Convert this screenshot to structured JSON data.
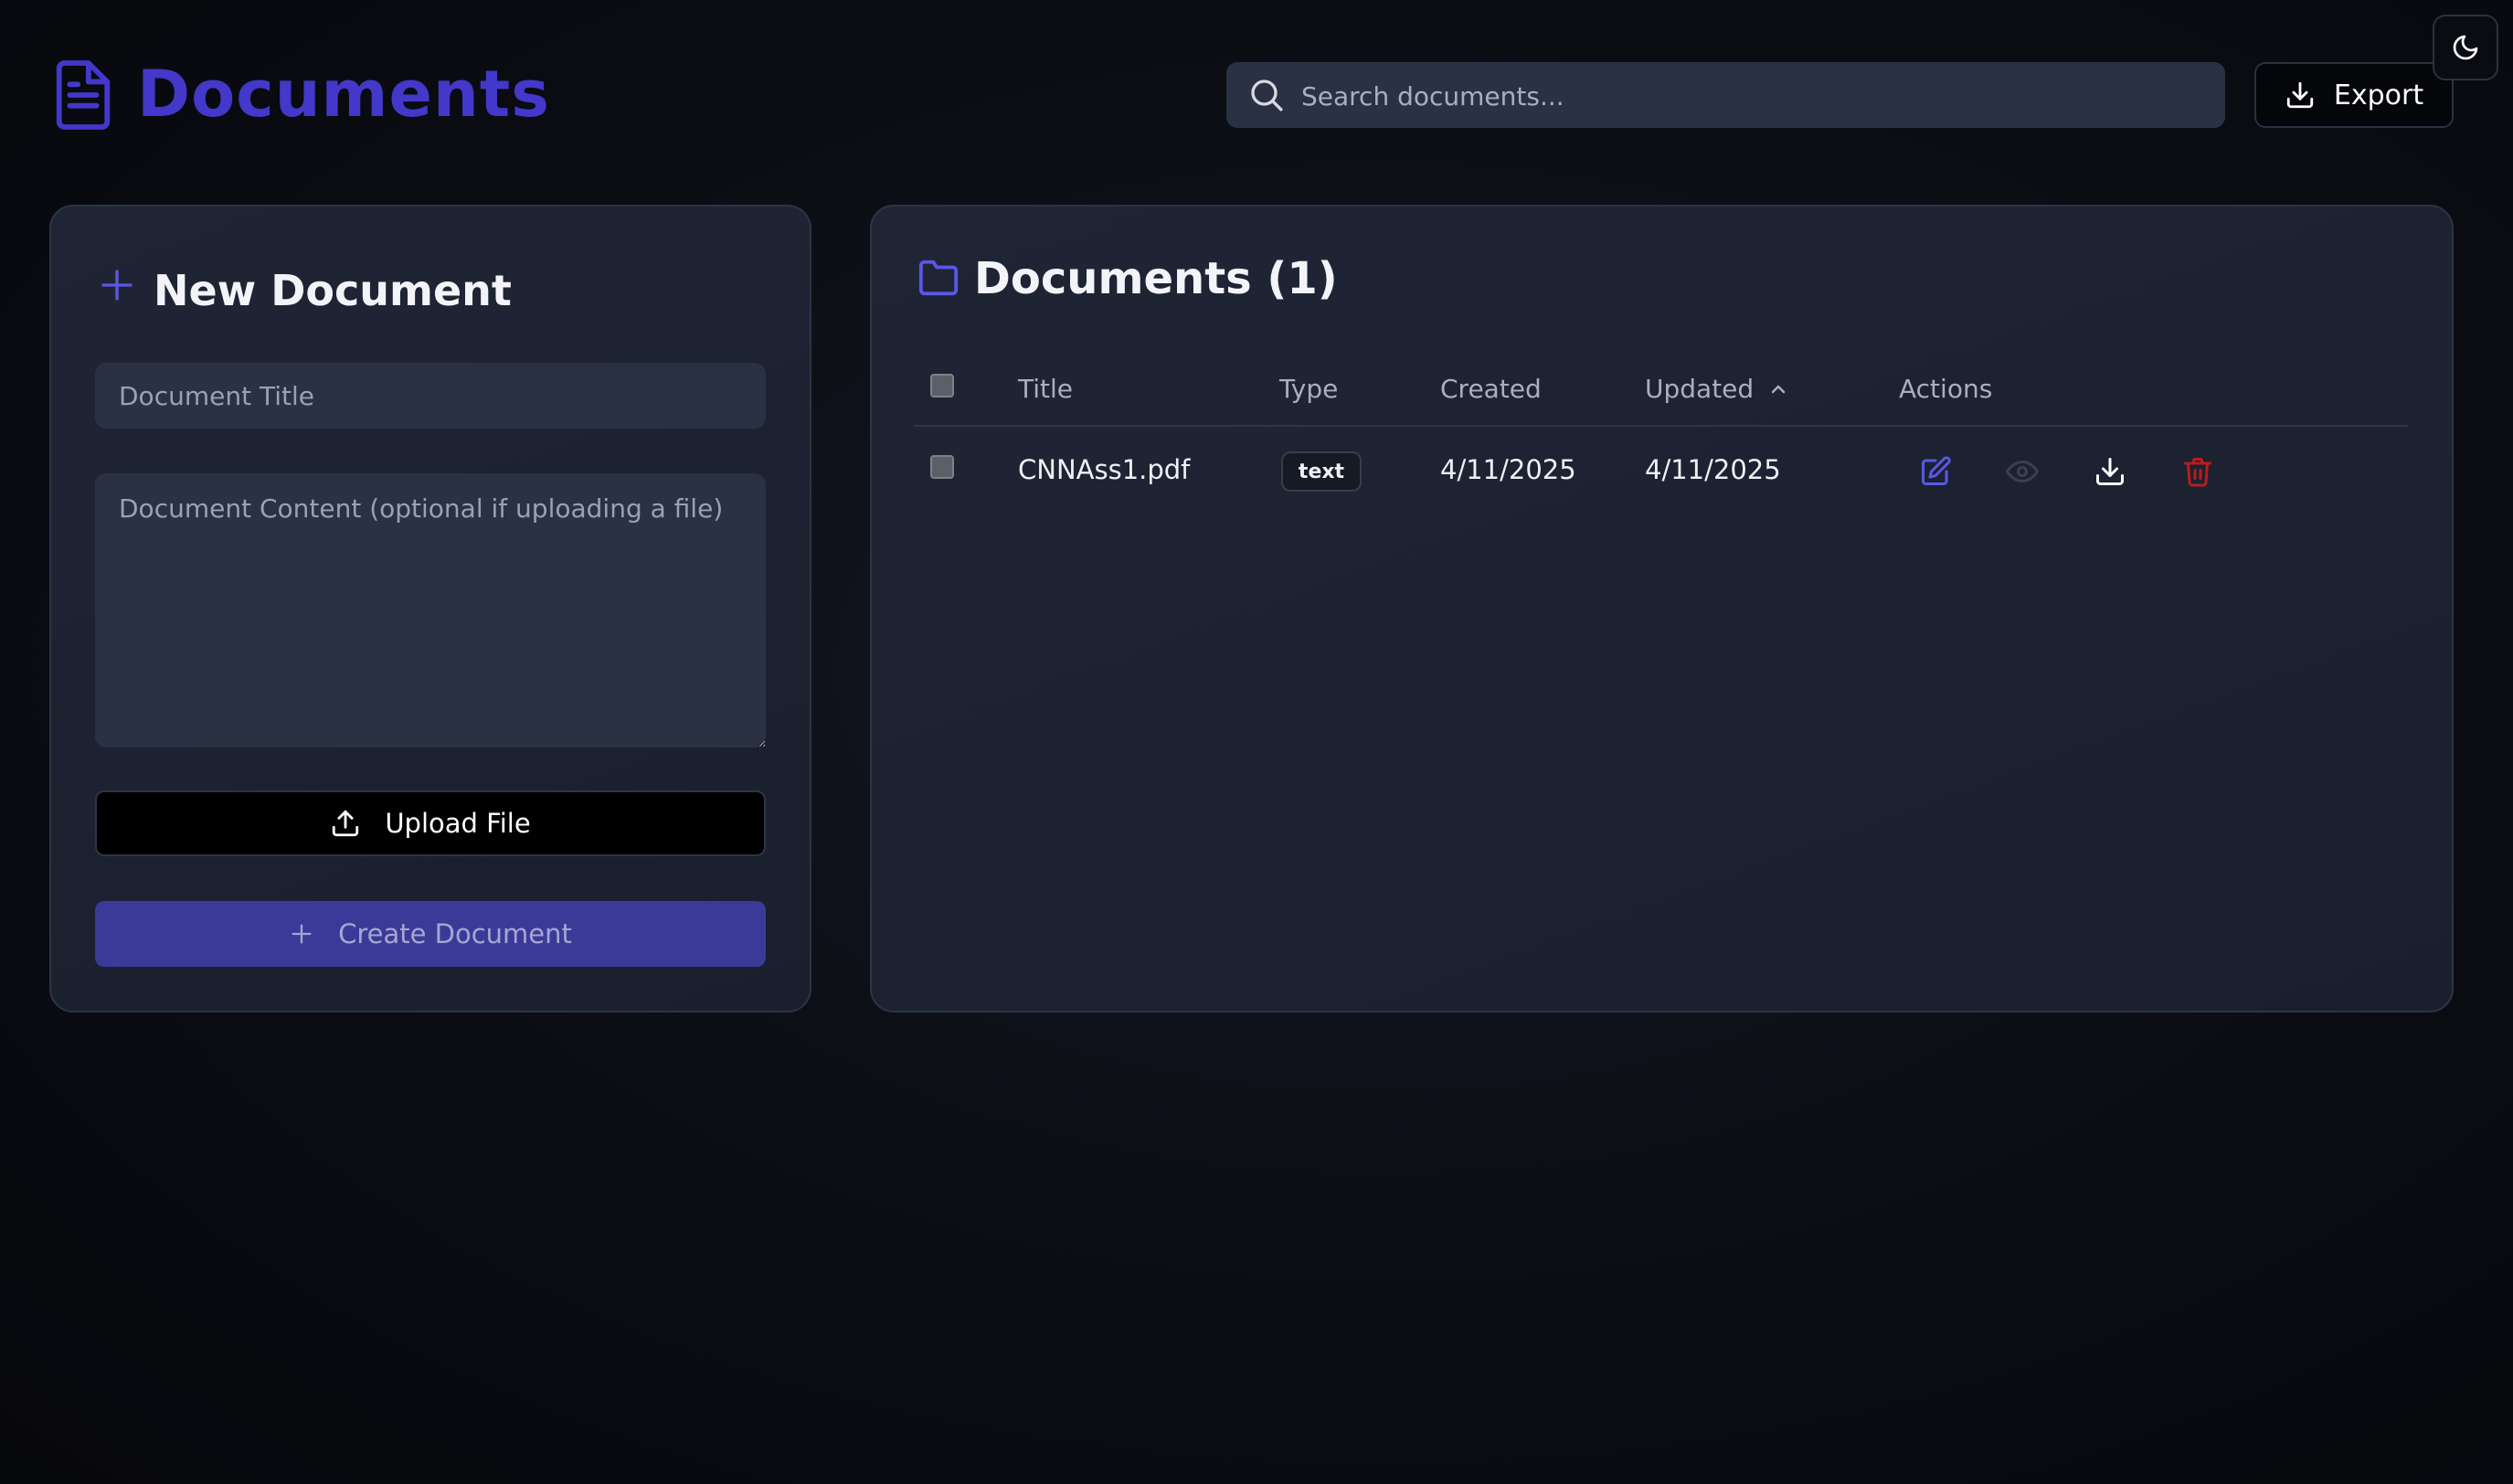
{
  "header": {
    "title": "Documents",
    "search_placeholder": "Search documents...",
    "export_label": "Export"
  },
  "new_document": {
    "heading": "New Document",
    "title_placeholder": "Document Title",
    "content_placeholder": "Document Content (optional if uploading a file)",
    "upload_label": "Upload File",
    "create_label": "Create Document"
  },
  "documents_panel": {
    "heading": "Documents (1)",
    "columns": [
      "Title",
      "Type",
      "Created",
      "Updated",
      "Actions"
    ],
    "rows": [
      {
        "title": "CNNAss1.pdf",
        "type": "text",
        "created": "4/11/2025",
        "updated": "4/11/2025"
      }
    ]
  },
  "icons": {
    "app_logo": "document-icon",
    "search": "search-icon",
    "export": "download-icon",
    "theme": "moon-icon",
    "new_doc": "plus-icon",
    "upload": "upload-icon",
    "create": "plus-icon",
    "folder": "folder-icon",
    "sort": "chevron-up-icon",
    "actions": [
      "edit-icon",
      "eye-icon",
      "download-icon",
      "trash-icon"
    ]
  },
  "colors": {
    "accent": "#4338ca",
    "create_button": "#3c3a99",
    "delete": "#b91c1c",
    "edit": "#5b57e8"
  }
}
